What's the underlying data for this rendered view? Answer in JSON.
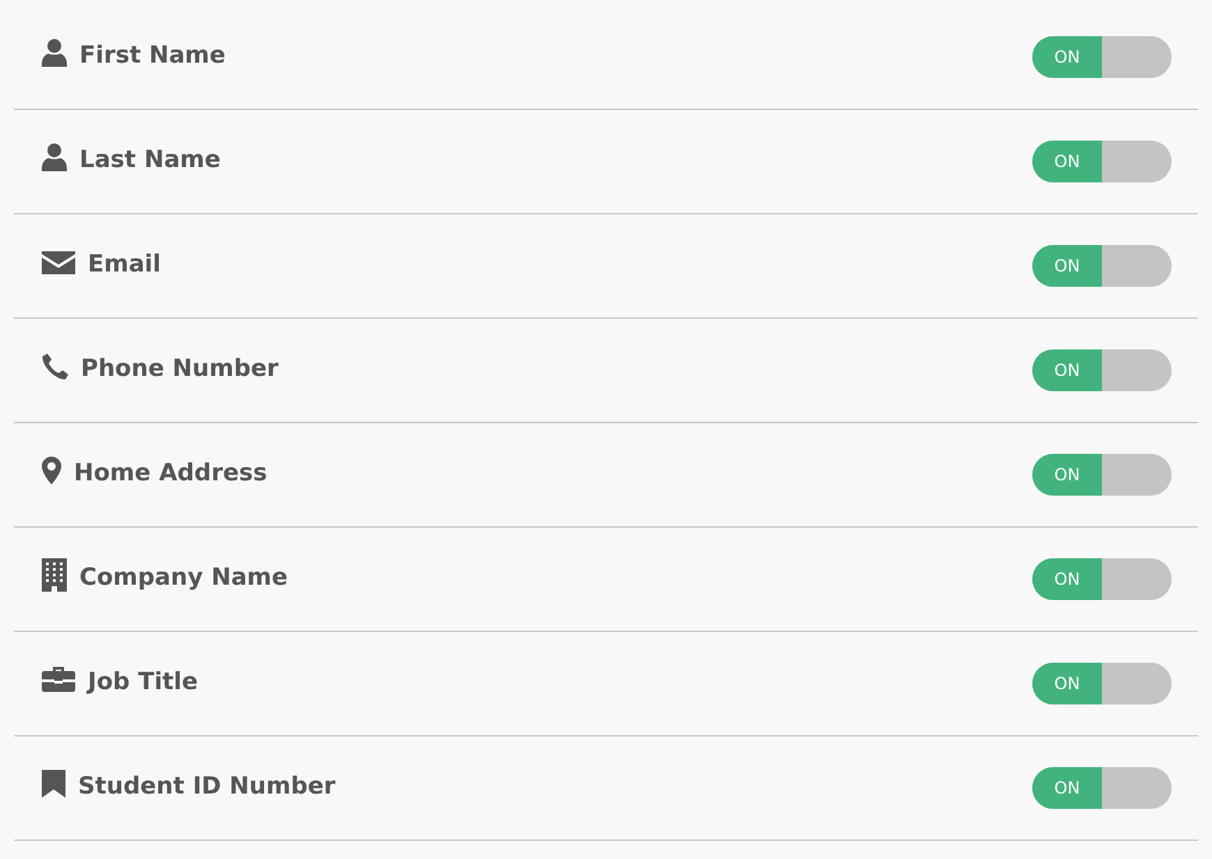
{
  "fields": [
    {
      "label": "First Name",
      "toggle": {
        "label": "ON",
        "on": true
      }
    },
    {
      "label": "Last Name",
      "toggle": {
        "label": "ON",
        "on": true
      }
    },
    {
      "label": "Email",
      "toggle": {
        "label": "ON",
        "on": true
      }
    },
    {
      "label": "Phone Number",
      "toggle": {
        "label": "ON",
        "on": true
      }
    },
    {
      "label": "Home Address",
      "toggle": {
        "label": "ON",
        "on": true
      }
    },
    {
      "label": "Company Name",
      "toggle": {
        "label": "ON",
        "on": true
      }
    },
    {
      "label": "Job Title",
      "toggle": {
        "label": "ON",
        "on": true
      }
    },
    {
      "label": "Student ID Number",
      "toggle": {
        "label": "ON",
        "on": true
      }
    }
  ]
}
